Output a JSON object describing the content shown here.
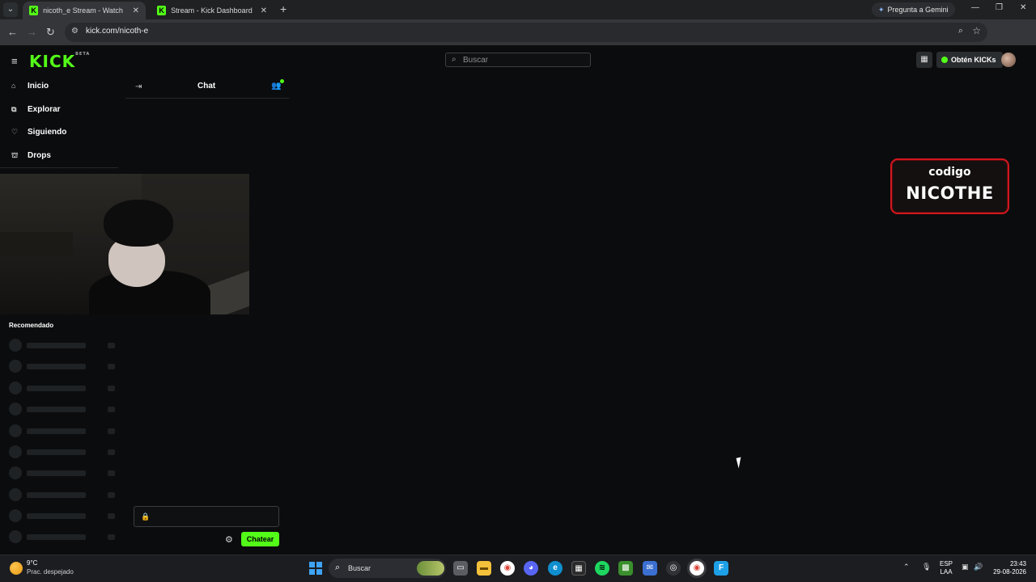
{
  "browser": {
    "tabs": [
      {
        "title": "nicoth_e Stream - Watch Live o",
        "favicon": "K",
        "active": true
      },
      {
        "title": "Stream - Kick Dashboard",
        "favicon": "K",
        "active": false
      }
    ],
    "gemini_label": "Pregunta a Gemini",
    "url": "kick.com/nicoth-e"
  },
  "kick": {
    "logo": "KICK",
    "logo_badge": "BETA",
    "search_placeholder": "Buscar",
    "get_kicks_label": "Obtén KICKs",
    "brand_color": "#53fc18",
    "nav": [
      {
        "label": "Inicio",
        "icon": "home-icon"
      },
      {
        "label": "Explorar",
        "icon": "compass-icon"
      },
      {
        "label": "Siguiendo",
        "icon": "heart-icon"
      },
      {
        "label": "Drops",
        "icon": "gift-icon"
      }
    ],
    "chat": {
      "title": "Chat",
      "send_label": "Chatear"
    },
    "recommended_title": "Recomendado",
    "overlay": {
      "small": "codigo",
      "big": "NICOTHE",
      "border_color": "#d0171f"
    }
  },
  "taskbar": {
    "temperature": "9°C",
    "weather": "Prac. despejado",
    "search_placeholder": "Buscar",
    "lang_top": "ESP",
    "lang_bottom": "LAA",
    "time": "23:43",
    "date": "29-08-2026"
  }
}
